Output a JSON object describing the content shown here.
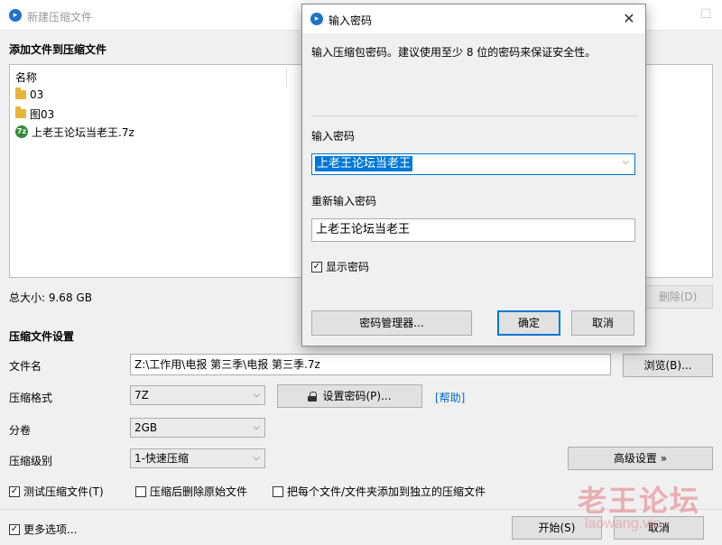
{
  "window": {
    "title": "新建压缩文件",
    "behind_title_1": "",
    "add_files_label": "添加文件到压缩文件"
  },
  "file_list": {
    "column_header": "名称",
    "items": [
      {
        "name": "03",
        "type": "folder"
      },
      {
        "name": "图03",
        "type": "folder"
      },
      {
        "name": "上老王论坛当老王.7z",
        "type": "archive"
      }
    ]
  },
  "total_size": "总大小: 9.68 GB",
  "delete_button": "删除(D)",
  "settings": {
    "section_label": "压缩文件设置",
    "filename_label": "文件名",
    "filename_value": "Z:\\工作用\\电报 第三季\\电报 第三季.7z",
    "browse_button": "浏览(B)...",
    "format_label": "压缩格式",
    "format_value": "7Z",
    "set_password_button": "设置密码(P)...",
    "help_link": "[帮助]",
    "split_label": "分卷",
    "split_value": "2GB",
    "level_label": "压缩级别",
    "level_value": "1-快速压缩",
    "advanced_button": "高级设置 »",
    "test_archive": "测试压缩文件(T)",
    "delete_after": "压缩后删除原始文件",
    "each_separate": "把每个文件/文件夹添加到独立的压缩文件",
    "more_options": "更多选项...",
    "start_button": "开始(S)",
    "cancel_button": "取消"
  },
  "checkboxes": {
    "test_archive": true,
    "delete_after": false,
    "each_separate": false,
    "more_options": true
  },
  "dialog": {
    "title": "输入密码",
    "description": "输入压缩包密码。建议使用至少 8 位的密码来保证安全性。",
    "password_label": "输入密码",
    "password_value": "上老王论坛当老王",
    "repeat_label": "重新输入密码",
    "repeat_value": "上老王论坛当老王",
    "show_password": "显示密码",
    "show_password_checked": true,
    "manager_button": "密码管理器...",
    "ok_button": "确定",
    "cancel_button": "取消"
  },
  "watermark": {
    "main": "老王论坛",
    "sub": "laowang.vip"
  },
  "icons": {
    "app": "app-icon",
    "folder": "folder-icon",
    "archive": "archive-icon",
    "lock": "lock-icon",
    "close": "close-icon",
    "chevron": "chevron-down-icon"
  },
  "colors": {
    "accent": "#0078d7",
    "link": "#0066cc",
    "folder": "#e8b53b",
    "watermark": "#e67882"
  }
}
